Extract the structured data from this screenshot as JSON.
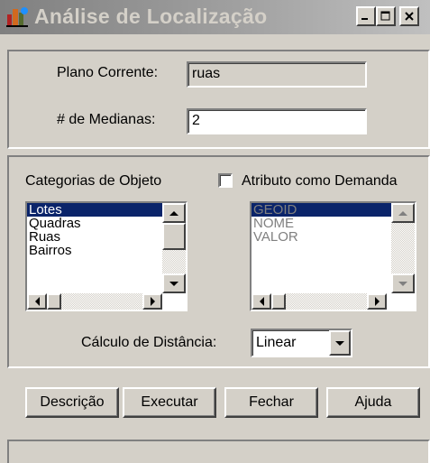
{
  "window": {
    "title": "Análise de Localização",
    "app_icon": "app-icon",
    "controls": [
      "minimize-icon",
      "maximize-icon",
      "close-icon"
    ]
  },
  "plan": {
    "current_plan_label": "Plano Corrente:",
    "current_plan_value": "ruas",
    "medians_label": "# de Medianas:",
    "medians_value": "2"
  },
  "categories": {
    "label": "Categorias de Objeto",
    "items": [
      "Lotes",
      "Quadras",
      "Ruas",
      "Bairros"
    ],
    "selected": "Lotes"
  },
  "attribute_demand": {
    "label": "Atributo como Demanda",
    "checked": false,
    "items": [
      "GEOID",
      "NOME",
      "VALOR"
    ],
    "selected": "GEOID"
  },
  "distance": {
    "label": "Cálculo de Distância:",
    "value": "Linear"
  },
  "buttons": {
    "description": "Descrição",
    "execute": "Executar",
    "close": "Fechar",
    "help": "Ajuda"
  },
  "colors": {
    "selection": "#0a246a",
    "face": "#d4d0c8"
  }
}
